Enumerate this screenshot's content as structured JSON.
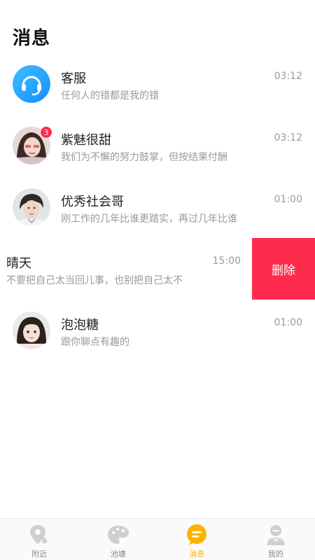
{
  "page": {
    "title": "消息"
  },
  "conversations": [
    {
      "name": "客服",
      "preview": "任何人的错都是我的错",
      "time": "03:12",
      "avatar": "headset-icon",
      "badge": ""
    },
    {
      "name": "紫魅很甜",
      "preview": "我们为不懈的努力鼓掌，但按结果付酬",
      "time": "03:12",
      "avatar": "user-photo",
      "badge": "3"
    },
    {
      "name": "优秀社会哥",
      "preview": "刚工作的几年比谁更踏实，再过几年比谁",
      "time": "01:00",
      "avatar": "user-photo",
      "badge": ""
    },
    {
      "name": "晴天",
      "preview": "不要把自己太当回儿事，也别把自己太不",
      "time": "15:00",
      "avatar": "",
      "badge": ""
    },
    {
      "name": "泡泡糖",
      "preview": "跟你聊点有趣的",
      "time": "01:00",
      "avatar": "user-photo",
      "badge": ""
    }
  ],
  "swipe_action": {
    "label": "删除"
  },
  "tabbar": {
    "items": [
      {
        "label": "附近",
        "icon": "location-pin-icon",
        "active": false
      },
      {
        "label": "池塘",
        "icon": "palette-icon",
        "active": false
      },
      {
        "label": "消息",
        "icon": "chat-bubble-icon",
        "active": true
      },
      {
        "label": "我的",
        "icon": "profile-icon",
        "active": false
      }
    ]
  },
  "colors": {
    "accent": "#ffb300",
    "delete": "#ff2b4c",
    "service": "#2ea7ff"
  }
}
